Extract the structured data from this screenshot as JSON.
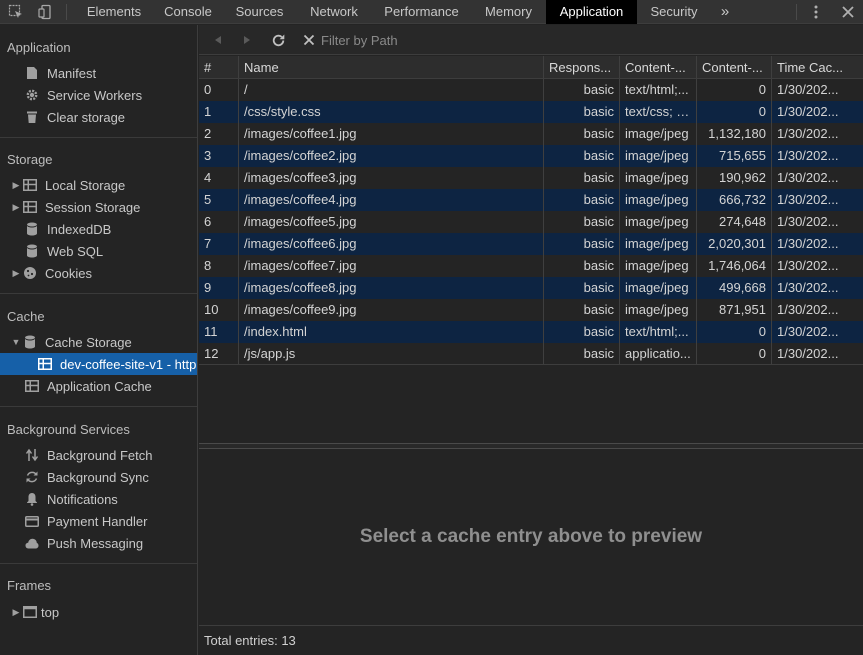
{
  "tabs": [
    {
      "label": "Elements"
    },
    {
      "label": "Console"
    },
    {
      "label": "Sources"
    },
    {
      "label": "Network"
    },
    {
      "label": "Performance"
    },
    {
      "label": "Memory"
    },
    {
      "label": "Application",
      "active": true
    },
    {
      "label": "Security"
    }
  ],
  "tab_overflow": "»",
  "sidebar": {
    "application_header": "Application",
    "application_items": [
      "Manifest",
      "Service Workers",
      "Clear storage"
    ],
    "storage_header": "Storage",
    "storage_items": [
      "Local Storage",
      "Session Storage",
      "IndexedDB",
      "Web SQL",
      "Cookies"
    ],
    "cache_header": "Cache",
    "cache_items": [
      "Cache Storage",
      "dev-coffee-site-v1 - http",
      "Application Cache"
    ],
    "background_header": "Background Services",
    "background_items": [
      "Background Fetch",
      "Background Sync",
      "Notifications",
      "Payment Handler",
      "Push Messaging"
    ],
    "frames_header": "Frames",
    "frames_items": [
      "top"
    ]
  },
  "toolbar": {
    "filter_placeholder": "Filter by Path"
  },
  "table": {
    "columns": [
      "#",
      "Name",
      "Respons...",
      "Content-...",
      "Content-...",
      "Time Cac..."
    ],
    "rows": [
      [
        "0",
        "/",
        "basic",
        "text/html;...",
        "0",
        "1/30/202..."
      ],
      [
        "1",
        "/css/style.css",
        "basic",
        "text/css; c...",
        "0",
        "1/30/202..."
      ],
      [
        "2",
        "/images/coffee1.jpg",
        "basic",
        "image/jpeg",
        "1,132,180",
        "1/30/202..."
      ],
      [
        "3",
        "/images/coffee2.jpg",
        "basic",
        "image/jpeg",
        "715,655",
        "1/30/202..."
      ],
      [
        "4",
        "/images/coffee3.jpg",
        "basic",
        "image/jpeg",
        "190,962",
        "1/30/202..."
      ],
      [
        "5",
        "/images/coffee4.jpg",
        "basic",
        "image/jpeg",
        "666,732",
        "1/30/202..."
      ],
      [
        "6",
        "/images/coffee5.jpg",
        "basic",
        "image/jpeg",
        "274,648",
        "1/30/202..."
      ],
      [
        "7",
        "/images/coffee6.jpg",
        "basic",
        "image/jpeg",
        "2,020,301",
        "1/30/202..."
      ],
      [
        "8",
        "/images/coffee7.jpg",
        "basic",
        "image/jpeg",
        "1,746,064",
        "1/30/202..."
      ],
      [
        "9",
        "/images/coffee8.jpg",
        "basic",
        "image/jpeg",
        "499,668",
        "1/30/202..."
      ],
      [
        "10",
        "/images/coffee9.jpg",
        "basic",
        "image/jpeg",
        "871,951",
        "1/30/202..."
      ],
      [
        "11",
        "/index.html",
        "basic",
        "text/html;...",
        "0",
        "1/30/202..."
      ],
      [
        "12",
        "/js/app.js",
        "basic",
        "applicatio...",
        "0",
        "1/30/202..."
      ]
    ]
  },
  "preview": {
    "message": "Select a cache entry above to preview"
  },
  "footer": {
    "total": "Total entries: 13"
  },
  "colors": {
    "selected_row": "#1660a8",
    "stripe": "#0d2442",
    "active_tab": "#000000"
  }
}
